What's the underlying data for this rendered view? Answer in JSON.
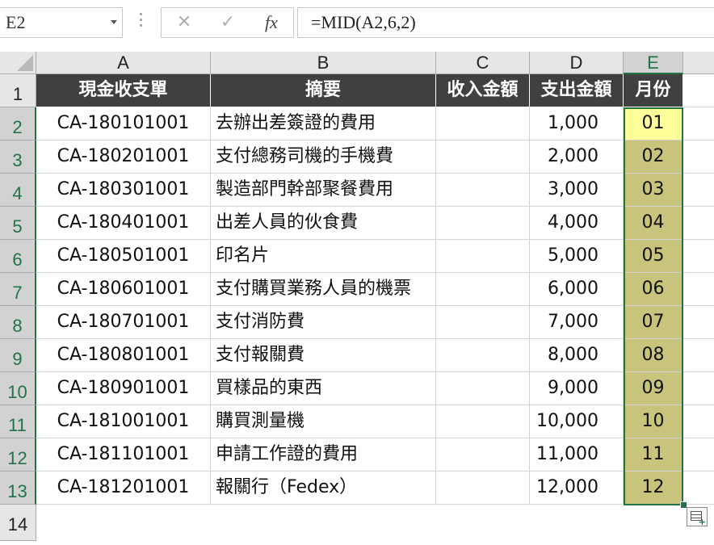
{
  "formula_bar": {
    "name_box": "E2",
    "cancel_glyph": "✕",
    "enter_glyph": "✓",
    "fx_label": "fx",
    "formula": "=MID(A2,6,2)"
  },
  "columns": [
    "A",
    "B",
    "C",
    "D",
    "E"
  ],
  "rows": [
    "1",
    "2",
    "3",
    "4",
    "5",
    "6",
    "7",
    "8",
    "9",
    "10",
    "11",
    "12",
    "13",
    "14"
  ],
  "headers": [
    "現金收支單",
    "摘要",
    "收入金額",
    "支出金額",
    "月份"
  ],
  "data": [
    {
      "id": "CA-180101001",
      "desc": "去辦出差簽證的費用",
      "income": "",
      "expense": "1,000",
      "month": "01"
    },
    {
      "id": "CA-180201001",
      "desc": "支付總務司機的手機費",
      "income": "",
      "expense": "2,000",
      "month": "02"
    },
    {
      "id": "CA-180301001",
      "desc": "製造部門幹部聚餐費用",
      "income": "",
      "expense": "3,000",
      "month": "03"
    },
    {
      "id": "CA-180401001",
      "desc": "出差人員的伙食費",
      "income": "",
      "expense": "4,000",
      "month": "04"
    },
    {
      "id": "CA-180501001",
      "desc": "印名片",
      "income": "",
      "expense": "5,000",
      "month": "05"
    },
    {
      "id": "CA-180601001",
      "desc": "支付購買業務人員的機票",
      "income": "",
      "expense": "6,000",
      "month": "06"
    },
    {
      "id": "CA-180701001",
      "desc": "支付消防費",
      "income": "",
      "expense": "7,000",
      "month": "07"
    },
    {
      "id": "CA-180801001",
      "desc": "支付報關費",
      "income": "",
      "expense": "8,000",
      "month": "08"
    },
    {
      "id": "CA-180901001",
      "desc": "買樣品的東西",
      "income": "",
      "expense": "9,000",
      "month": "09"
    },
    {
      "id": "CA-181001001",
      "desc": "購買測量機",
      "income": "",
      "expense": "10,000",
      "month": "10"
    },
    {
      "id": "CA-181101001",
      "desc": "申請工作證的費用",
      "income": "",
      "expense": "11,000",
      "month": "11"
    },
    {
      "id": "CA-181201001",
      "desc": "報關行（Fedex）",
      "income": "",
      "expense": "12,000",
      "month": "12"
    }
  ],
  "colors": {
    "header_bg": "#404040",
    "selection": "#217346",
    "month_fill": "#c8c47c",
    "active_fill": "#ffff9a"
  }
}
